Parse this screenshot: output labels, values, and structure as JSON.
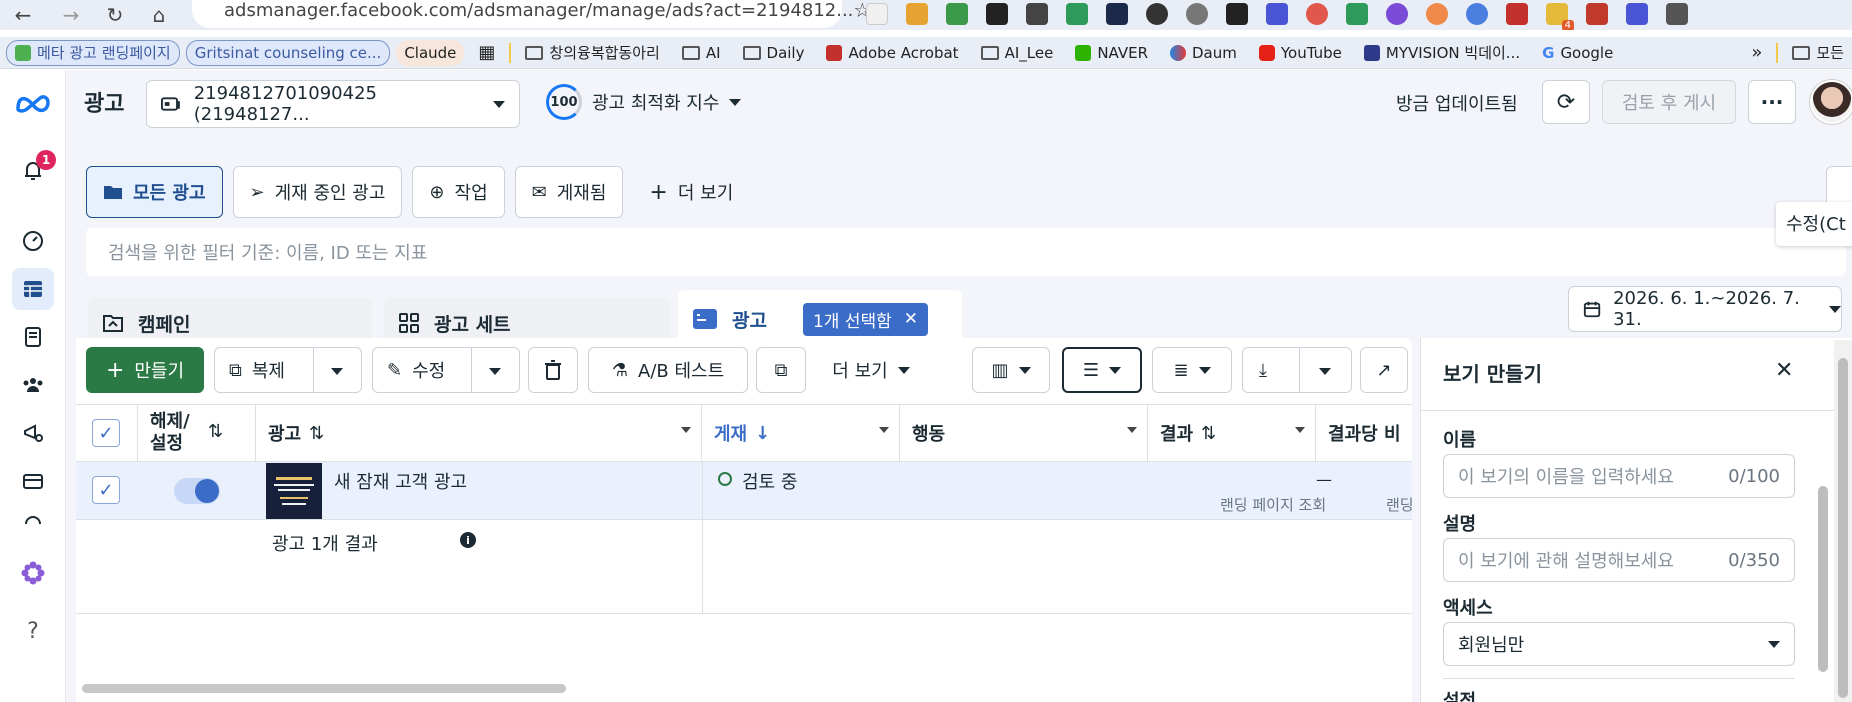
{
  "browser": {
    "url": "adsmanager.facebook.com/adsmanager/manage/ads?act=2194812...",
    "ext_badge": "4",
    "bookmarks": [
      {
        "label": "메타 광고 랜딩페이지",
        "kind": "pill"
      },
      {
        "label": "Gritsinat counseling ce...",
        "kind": "pill"
      },
      {
        "label": "Claude",
        "kind": "plain"
      },
      {
        "label": "창의융복합동아리",
        "kind": "folder"
      },
      {
        "label": "AI",
        "kind": "folder"
      },
      {
        "label": "Daily",
        "kind": "folder"
      },
      {
        "label": "Adobe Acrobat",
        "kind": "pdf"
      },
      {
        "label": "AI_Lee",
        "kind": "folder"
      },
      {
        "label": "NAVER",
        "kind": "naver"
      },
      {
        "label": "Daum",
        "kind": "daum"
      },
      {
        "label": "YouTube",
        "kind": "youtube"
      },
      {
        "label": "MYVISION 빅데이...",
        "kind": "myvision"
      },
      {
        "label": "Google",
        "kind": "google"
      },
      {
        "label": "모든",
        "kind": "folder"
      }
    ]
  },
  "rail": {
    "notification_count": "1"
  },
  "topbar": {
    "title": "광고",
    "account": "2194812701090425 (21948127...",
    "score": "100",
    "score_label": "광고 최적화 지수",
    "updated": "방금 업데이트됨",
    "publish": "검토 후 게시"
  },
  "tabs": [
    {
      "label": "모든 광고",
      "active": true
    },
    {
      "label": "게재 중인 광고",
      "active": false
    },
    {
      "label": "작업",
      "active": false
    },
    {
      "label": "게재됨",
      "active": false
    },
    {
      "label": "더 보기",
      "active": false
    }
  ],
  "search": {
    "placeholder": "검색을 위한 필터 기준: 이름, ID 또는 지표"
  },
  "tooltip": "수정(Ct",
  "levels": {
    "campaign": "캠페인",
    "adset": "광고 세트",
    "ad": "광고",
    "selected_chip": "1개 선택함"
  },
  "date_range": "2026. 6. 1.~2026. 7. 31.",
  "toolbar": {
    "create": "만들기",
    "duplicate": "복제",
    "edit": "수정",
    "ab_test": "A/B 테스트",
    "more": "더 보기"
  },
  "grid": {
    "columns": {
      "toggle": "해제/",
      "toggle2": "설정",
      "ad": "광고",
      "delivery": "게재",
      "actions": "행동",
      "results": "결과",
      "cost_per": "결과당 비"
    },
    "row": {
      "ad_name": "새 잠재 고객 광고",
      "delivery_status": "검토 중",
      "results_value": "—",
      "results_sub": "랜딩 페이지 조회",
      "cost_sub": "랜딩"
    },
    "summary": "광고 1개 결과"
  },
  "view_panel": {
    "title": "보기 만들기",
    "name_label": "이름",
    "name_placeholder": "이 보기의 이름을 입력하세요",
    "name_count": "0/100",
    "desc_label": "설명",
    "desc_placeholder": "이 보기에 관해 설명해보세요",
    "desc_count": "0/350",
    "access_label": "액세스",
    "access_value": "회원님만",
    "settings_label": "설정"
  },
  "colors": {
    "accent": "#3b6cc7",
    "create_green": "#2b7a46",
    "notification_red": "#e0245e"
  }
}
